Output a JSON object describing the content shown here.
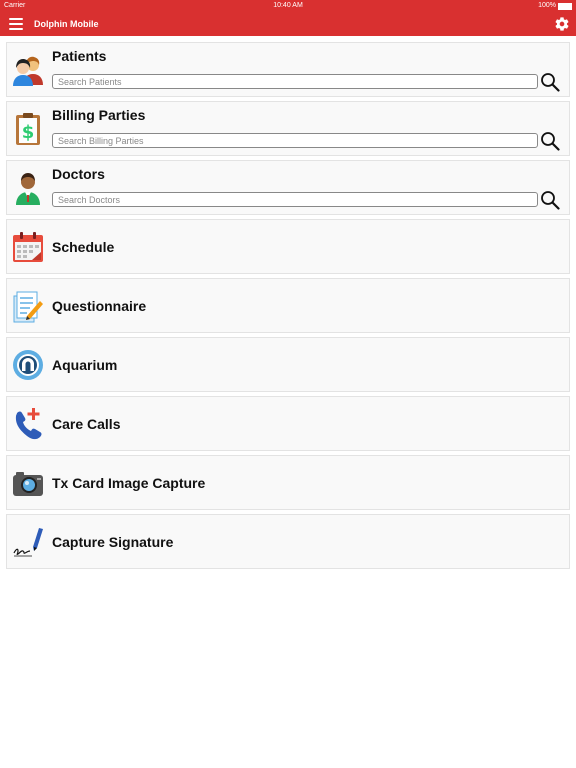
{
  "status_bar": {
    "carrier": "Carrier",
    "time": "10:40 AM",
    "battery": "100%",
    "battery_level": 1.0
  },
  "nav": {
    "title": "Dolphin Mobile"
  },
  "search_items": [
    {
      "label": "Patients",
      "placeholder": "Search Patients",
      "icon": "patients-icon"
    },
    {
      "label": "Billing Parties",
      "placeholder": "Search Billing Parties",
      "icon": "billing-icon"
    },
    {
      "label": "Doctors",
      "placeholder": "Search Doctors",
      "icon": "doctor-icon"
    }
  ],
  "menu_items": [
    {
      "label": "Schedule",
      "icon": "calendar-icon"
    },
    {
      "label": "Questionnaire",
      "icon": "questionnaire-icon"
    },
    {
      "label": "Aquarium",
      "icon": "aquarium-icon"
    },
    {
      "label": "Care Calls",
      "icon": "phone-plus-icon"
    },
    {
      "label": "Tx Card Image Capture",
      "icon": "camera-icon"
    },
    {
      "label": "Capture Signature",
      "icon": "pen-signature-icon"
    }
  ],
  "colors": {
    "header": "#d93030",
    "card_bg": "#f9f9f9",
    "card_border": "#e3e3e3"
  }
}
